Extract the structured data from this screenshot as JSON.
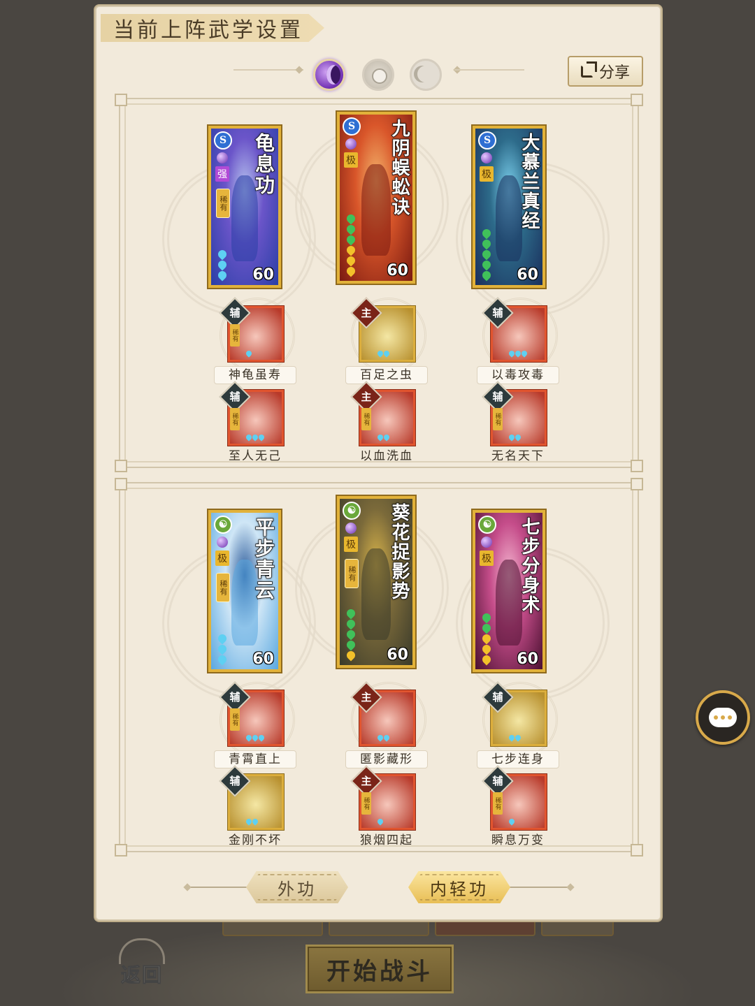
{
  "panel": {
    "title": "当前上阵武学设置",
    "share_label": "分享",
    "selectors": [
      {
        "name": "moon-selector",
        "active": true
      },
      {
        "name": "sun-selector",
        "active": false
      },
      {
        "name": "crescent-selector",
        "active": false
      }
    ]
  },
  "groups": [
    {
      "cards": [
        {
          "name": "龟息功",
          "grade": "强",
          "rarity": "稀有",
          "level": "60",
          "beads": [
            "blue",
            "blue",
            "blue"
          ],
          "school_icon": "water-swirl-icon",
          "colors": [
            "#2a3fa6",
            "#6b55c9",
            "#b9c6ef"
          ]
        },
        {
          "name": "九阴蜈蚣诀",
          "grade": "极",
          "rarity": "",
          "level": "60",
          "beads": [
            "gold",
            "gold",
            "gold",
            "green",
            "green",
            "green"
          ],
          "school_icon": "water-swirl-icon",
          "colors": [
            "#7a1a10",
            "#d9562a",
            "#f2b36b"
          ]
        },
        {
          "name": "大慕兰真经",
          "grade": "极",
          "rarity": "",
          "level": "60",
          "beads": [
            "green",
            "green",
            "green",
            "green",
            "green"
          ],
          "school_icon": "water-swirl-icon",
          "colors": [
            "#1a2f5c",
            "#2d6b8a",
            "#7ed3f0"
          ]
        }
      ],
      "skills": [
        {
          "label": "神龟虽寿",
          "tag": "辅",
          "rarity": "稀有",
          "beads": 1
        },
        {
          "label": "百足之虫",
          "tag": "主",
          "rarity": "",
          "beads": 2
        },
        {
          "label": "以毒攻毒",
          "tag": "辅",
          "rarity": "",
          "beads": 3
        },
        {
          "label": "至人无己",
          "tag": "辅",
          "rarity": "稀有",
          "beads": 3
        },
        {
          "label": "以血洗血",
          "tag": "主",
          "rarity": "稀有",
          "beads": 2
        },
        {
          "label": "无名天下",
          "tag": "辅",
          "rarity": "稀有",
          "beads": 2
        }
      ]
    },
    {
      "cards": [
        {
          "name": "平步青云",
          "grade": "极",
          "rarity": "稀有",
          "level": "60",
          "beads": [
            "blue",
            "blue",
            "blue"
          ],
          "school_icon": "leaf-swirl-icon",
          "colors": [
            "#5aa8e0",
            "#cfe6f6",
            "#2b5a9a"
          ]
        },
        {
          "name": "葵花捉影势",
          "grade": "极",
          "rarity": "稀有",
          "level": "60",
          "beads": [
            "gold",
            "green",
            "green",
            "green",
            "green"
          ],
          "school_icon": "leaf-swirl-icon",
          "colors": [
            "#3a3a2a",
            "#7b6a3a",
            "#d6b24a"
          ]
        },
        {
          "name": "七步分身术",
          "grade": "极",
          "rarity": "",
          "level": "60",
          "beads": [
            "gold",
            "gold",
            "gold",
            "green",
            "green"
          ],
          "school_icon": "leaf-swirl-icon",
          "colors": [
            "#4a1030",
            "#c54d8a",
            "#f3b5cf"
          ]
        }
      ],
      "skills": [
        {
          "label": "青霄直上",
          "tag": "辅",
          "rarity": "稀有",
          "beads": 3
        },
        {
          "label": "匿影藏形",
          "tag": "主",
          "rarity": "",
          "beads": 2
        },
        {
          "label": "七步连身",
          "tag": "辅",
          "rarity": "",
          "beads": 2
        },
        {
          "label": "金刚不坏",
          "tag": "辅",
          "rarity": "",
          "beads": 2
        },
        {
          "label": "狼烟四起",
          "tag": "主",
          "rarity": "稀有",
          "beads": 1
        },
        {
          "label": "瞬息万变",
          "tag": "辅",
          "rarity": "稀有",
          "beads": 1
        }
      ]
    }
  ],
  "tabs": [
    {
      "label": "外功",
      "active": false
    },
    {
      "label": "内轻功",
      "active": true
    }
  ],
  "footer": {
    "back_label": "返回",
    "start_label": "开始战斗"
  },
  "icons": {
    "chat": "chat-bubble-icon",
    "share": "share-export-icon",
    "back": "back-arrow-icon"
  }
}
